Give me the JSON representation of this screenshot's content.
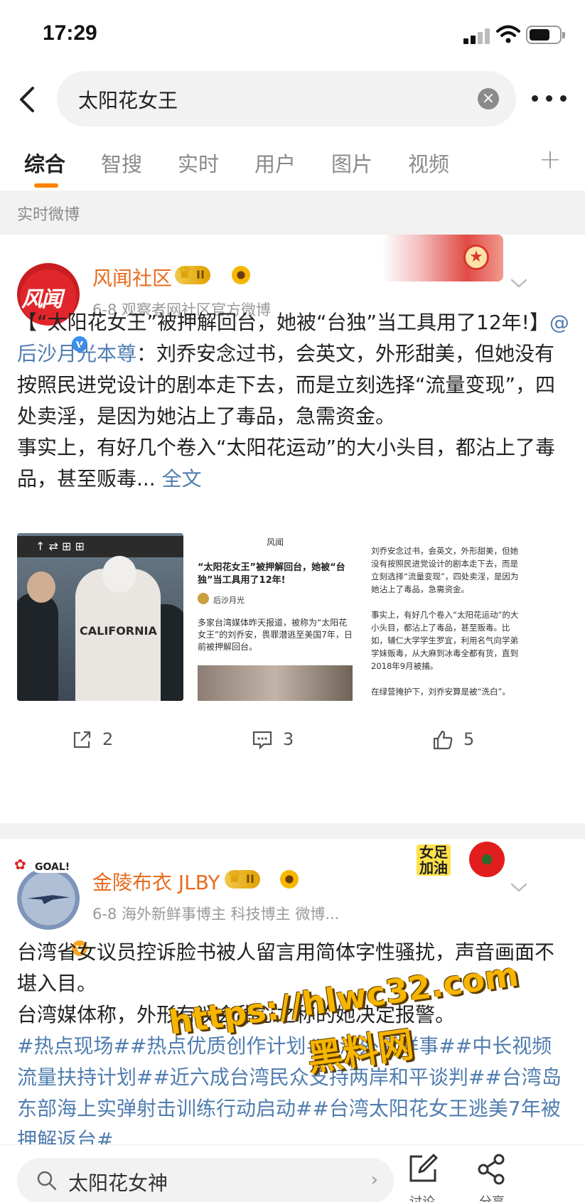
{
  "status_bar": {
    "time": "17:29"
  },
  "header": {
    "query": "太阳花女王",
    "clear_glyph": "×"
  },
  "tabs": [
    {
      "label": "综合",
      "active": true
    },
    {
      "label": "智搜",
      "active": false
    },
    {
      "label": "实时",
      "active": false
    },
    {
      "label": "用户",
      "active": false
    },
    {
      "label": "图片",
      "active": false
    },
    {
      "label": "视频",
      "active": false
    }
  ],
  "tab_add_glyph": "+",
  "section_label": "实时微博",
  "posts": [
    {
      "author": "风闻社区",
      "avatar_text": "风闻",
      "level": "II",
      "meta": "6-8  观察者网社区官方微博",
      "verified": "v",
      "banner_icon": "★",
      "text_lines": {
        "p1_pre": "【“太阳花女王”被押解回台，她被“台独”当工具用了12年!】",
        "p1_mention": "@后沙月光本尊",
        "p1_post": "：刘乔安念过书，会英文，外形甜美，但她没有按照民进党设计的剧本走下去，而是立刻选择“流量变现”，四处卖淫，是因为她沾上了毒品，急需资金。",
        "p2": "事实上，有好几个卷入“太阳花运动”的大小头目，都沾上了毒品，甚至贩毒...",
        "more": "全文"
      },
      "images": {
        "img1_sign": "↑ ⇄ ⊞ ⊞",
        "img1_shirt": "CALIFORNIA",
        "img2_title": "风闻",
        "img2_headline": "“太阳花女王”被押解回台，她被“台独”当工具用了12年!",
        "img2_author": "后沙月光",
        "img2_body": "多家台湾媒体昨天报道，被称为“太阳花女王”的刘乔安，畏罪潜逃至美国7年，日前被押解回台。",
        "img3_body": "刘乔安念过书，会英文，外形甜美，但她没有按照民进党设计的剧本走下去，而是立刻选择“流量变现”，四处卖淫，是因为她沾上了毒品，急需资金。\n\n事实上，有好几个卷入“太阳花运动”的大小头目，都沾上了毒品，甚至贩毒。比如，辅仁大学学生罗宜，利用名气向学弟学妹贩毒，从大麻到冰毒全都有货，直到2018年9月被捕。\n\n在绿营掩护下，刘乔安算是被“洗白”。\n\n出来后，她说自己准备签约当艺人，艺名“乔"
      },
      "actions": {
        "repost": "2",
        "comment": "3",
        "like": "5"
      }
    },
    {
      "author": "金陵布衣 JLBY",
      "level": "II",
      "meta": "6-8  海外新鲜事博主 科技博主 微博...",
      "verified": "v",
      "avatar_deco": "GOAL!",
      "sticker_text": "女足\n加油",
      "p1": "台湾省女议员控诉脸书被人留言用简体字性骚扰，声音画面不堪入目。",
      "p2": "台湾媒体称，外形有议会甜心之称的她决定报警。",
      "hashtags": "#热点现场##热点优质创作计划##海外新鲜事##中长视频流量扶持计划##近六成台湾民众支持两岸和平谈判##台湾岛东部海上实弹射击训练行动启动##台湾太阳花女王逃美7年被押解返台#"
    }
  ],
  "watermark": {
    "line1": "https://hlwc32.com",
    "line2": "黑料网"
  },
  "bottom_bar": {
    "search_text": "太阳花女神",
    "comment_label": "讨论",
    "share_label": "分享"
  }
}
